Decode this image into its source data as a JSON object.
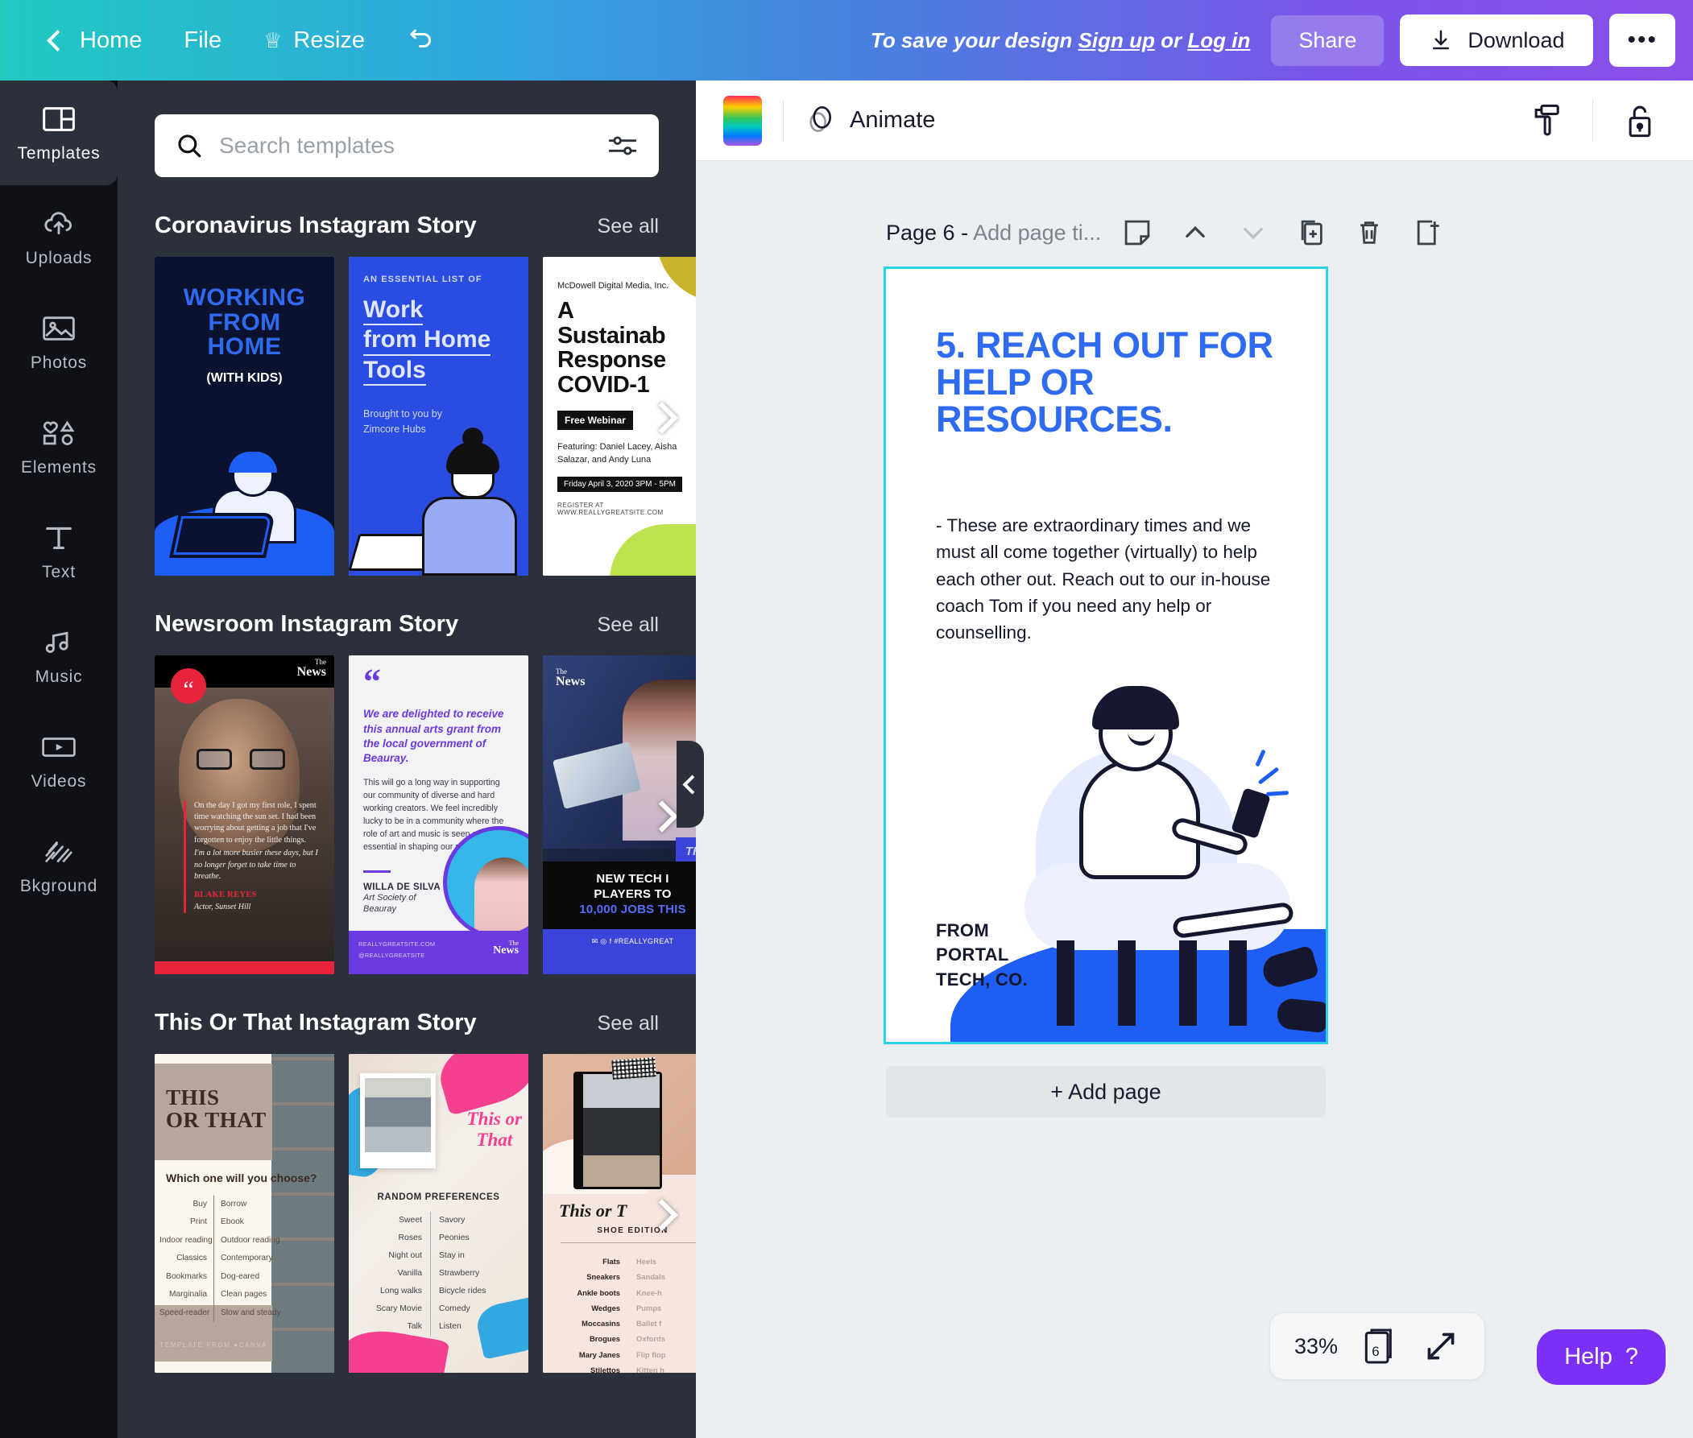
{
  "topbar": {
    "back_label": "Home",
    "file_label": "File",
    "resize_label": "Resize",
    "undo_name": "undo-icon",
    "save_hint_prefix": "To save your design ",
    "signup_label": "Sign up",
    "save_hint_mid": " or ",
    "login_label": "Log in",
    "share_label": "Share",
    "download_label": "Download",
    "more_label": "•••"
  },
  "rail": {
    "items": [
      {
        "label": "Templates",
        "icon": "templates-icon",
        "active": true
      },
      {
        "label": "Uploads",
        "icon": "cloud-upload-icon",
        "active": false
      },
      {
        "label": "Photos",
        "icon": "image-icon",
        "active": false
      },
      {
        "label": "Elements",
        "icon": "shapes-icon",
        "active": false
      },
      {
        "label": "Text",
        "icon": "text-icon",
        "active": false
      },
      {
        "label": "Music",
        "icon": "music-note-icon",
        "active": false
      },
      {
        "label": "Videos",
        "icon": "video-icon",
        "active": false
      },
      {
        "label": "Bkground",
        "icon": "pattern-icon",
        "active": false
      }
    ]
  },
  "search": {
    "placeholder": "Search templates",
    "value": "",
    "filter_icon": "sliders-icon",
    "search_icon": "search-icon"
  },
  "sections": [
    {
      "title": "Coronavirus Instagram Story",
      "see_all": "See all"
    },
    {
      "title": "Newsroom Instagram Story",
      "see_all": "See all"
    },
    {
      "title": "This Or That Instagram Story",
      "see_all": "See all"
    }
  ],
  "templates": {
    "wfh": {
      "title_line1": "WORKING",
      "title_line2": "FROM",
      "title_line3": "HOME",
      "subtitle": "(WITH KIDS)"
    },
    "tools": {
      "kicker": "AN ESSENTIAL LIST OF",
      "l1": "Work",
      "l2": "from Home",
      "l3": "Tools",
      "by1": "Brought to you by",
      "by2": "Zimcore Hubs"
    },
    "covid": {
      "org": "McDowell Digital Media, Inc.",
      "h1": "A",
      "h2": "Sustainab",
      "h3": "Response",
      "h4": "COVID-1",
      "badge": "Free Webinar",
      "featuring": "Featuring: Daniel Lacey, Aisha Salazar, and Andy Luna",
      "when": "Friday April 3, 2020 3PM - 5PM",
      "register": "REGISTER AT WWW.REALLYGREATSITE.COM"
    },
    "news1": {
      "logo_top": "The",
      "logo_main": "News",
      "quote": "On the day I got my first role, I spent time watching the sun set. I had been worrying about getting a job that I've forgotten to enjoy the little things.",
      "quote_em": "I'm a lot more busier these days, but I no longer forget to take time to breathe.",
      "name": "BLAKE REYES",
      "role": "Actor, Sunset Hill"
    },
    "news2": {
      "mark": "“",
      "lead": "We are delighted to receive this annual arts grant from the local government of Beauray.",
      "body": "This will go a long way in supporting our community of diverse and hard working creators. We feel incredibly lucky to be in a community where the role of art and music is seen as essential in shaping our society.",
      "name": "WILLA DE SILVA",
      "role1": "Art Society of",
      "role2": "Beauray",
      "foot1": "REALLYGREATSITE.COM",
      "foot2": "@REALLYGREATSITE",
      "logo_top": "The",
      "logo_main": "News"
    },
    "news3": {
      "logo_top": "The",
      "logo_main": "News",
      "tag": "THIS",
      "hl1": "NEW TECH I",
      "hl2": "PLAYERS TO",
      "hl3": "10,000 JOBS THIS",
      "foot": "✉ ◎ f  #REALLYGREAT"
    },
    "tot1": {
      "title_l1": "THIS",
      "title_l2": "OR THAT",
      "question": "Which one will you choose?",
      "left": [
        "Buy",
        "Print",
        "Indoor reading",
        "Classics",
        "Bookmarks",
        "Marginalia",
        "Speed-reader"
      ],
      "right": [
        "Borrow",
        "Ebook",
        "Outdoor reading",
        "Contemporary",
        "Dog-eared",
        "Clean pages",
        "Slow and steady"
      ],
      "footer": "TEMPLATE FROM ●CANVA"
    },
    "tot2": {
      "script_l1": "This or",
      "script_l2": "That",
      "heading": "RANDOM PREFERENCES",
      "left": [
        "Sweet",
        "Roses",
        "Night out",
        "Vanilla",
        "Long walks",
        "Scary Movie",
        "Talk"
      ],
      "right": [
        "Savory",
        "Peonies",
        "Stay in",
        "Strawberry",
        "Bicycle rides",
        "Comedy",
        "Listen"
      ]
    },
    "tot3": {
      "script": "This or T",
      "edition": "SHOE EDITION",
      "left": [
        "Flats",
        "Sneakers",
        "Ankle boots",
        "Wedges",
        "Moccasins",
        "Brogues",
        "Mary Janes",
        "Stilettos"
      ],
      "right": [
        "Heels",
        "Sandals",
        "Knee-h",
        "Pumps",
        "Ballet f",
        "Oxfords",
        "Flip flop",
        "Kitten h"
      ]
    }
  },
  "editor": {
    "color_swatch_name": "color-picker-swatch",
    "animate_label": "Animate",
    "tool_roller": "paint-roller-icon",
    "tool_lock": "lock-open-icon",
    "page_title": "Page 6 - ",
    "page_title_placeholder": "Add page ti...",
    "page_icons": [
      "notes-icon",
      "move-up-icon",
      "move-down-icon",
      "duplicate-page-icon",
      "delete-page-icon",
      "add-page-after-icon"
    ],
    "collapse_panel_icon": "chevron-left-icon"
  },
  "canvas": {
    "heading": "5. REACH OUT FOR HELP OR RESOURCES.",
    "body": "- These are extraordinary times and we must all come together (virtually) to help each other out. Reach out to our in-house coach Tom if you need any help or counselling.",
    "from_l1": "FROM",
    "from_l2": "PORTAL",
    "from_l3": "TECH, CO."
  },
  "bottom": {
    "add_page_label": "+ Add page",
    "zoom_level": "33%",
    "page_count": "6",
    "fullscreen_icon": "expand-icon",
    "help_label": "Help",
    "help_mark": "?"
  },
  "colors": {
    "accent_blue": "#2f6bf0",
    "canvas_outline": "#2ad2e8",
    "purple": "#7b2ff7",
    "panel_bg": "#2b303b",
    "rail_bg": "#0f1117"
  }
}
